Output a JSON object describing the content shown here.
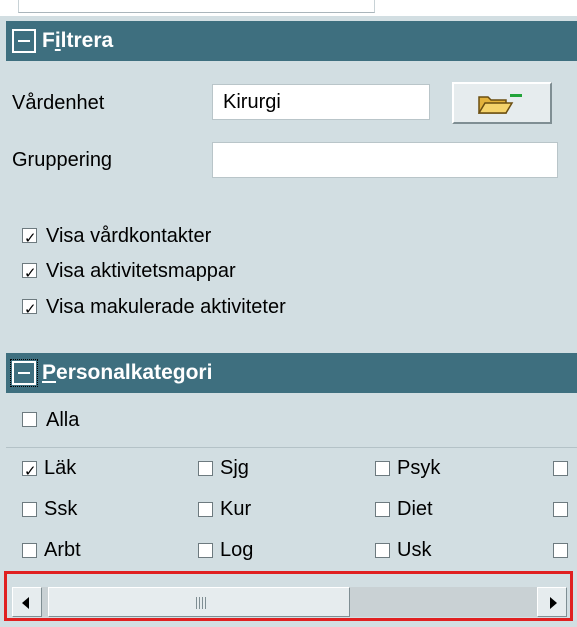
{
  "filter_section": {
    "title_prefix": "F",
    "title_underlined": "i",
    "title_rest": "ltrera",
    "vardenhet_label": "Vårdenhet",
    "vardenhet_value": "Kirurgi",
    "gruppering_label": "Gruppering",
    "gruppering_value": "",
    "checkboxes": [
      {
        "label": "Visa vårdkontakter",
        "checked": true
      },
      {
        "label": "Visa aktivitetsmappar",
        "checked": true
      },
      {
        "label": "Visa makulerade aktiviteter",
        "checked": true
      }
    ]
  },
  "personal_section": {
    "title_underlined": "P",
    "title_rest": "ersonalkategori",
    "all_label": "Alla",
    "all_checked": false,
    "categories": [
      [
        {
          "label": "Läk",
          "checked": true
        },
        {
          "label": "Sjg",
          "checked": false
        },
        {
          "label": "Psyk",
          "checked": false
        }
      ],
      [
        {
          "label": "Ssk",
          "checked": false
        },
        {
          "label": "Kur",
          "checked": false
        },
        {
          "label": "Diet",
          "checked": false
        }
      ],
      [
        {
          "label": "Arbt",
          "checked": false
        },
        {
          "label": "Log",
          "checked": false
        },
        {
          "label": "Usk",
          "checked": false
        }
      ]
    ]
  },
  "icons": {
    "toggle": "collapse-minus-icon",
    "folder": "folder-open-icon",
    "dropdown": "chevron-down-icon",
    "scroll_left": "arrow-left-icon",
    "scroll_right": "arrow-right-icon"
  },
  "colors": {
    "header_bg": "#3e6f7f",
    "panel_bg": "#d2dee2",
    "highlight": "#e02020"
  }
}
